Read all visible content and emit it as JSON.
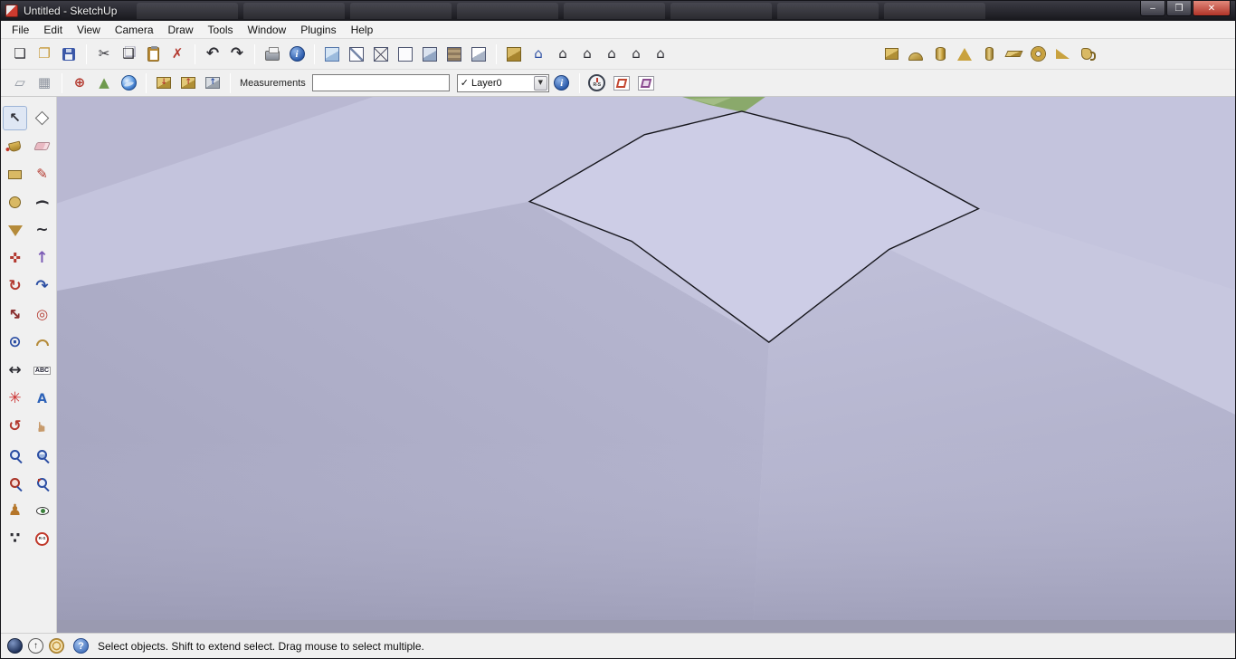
{
  "window": {
    "title": "Untitled - SketchUp",
    "controls": {
      "minimize": "–",
      "maximize": "❒",
      "close": "✕"
    }
  },
  "menu": {
    "items": [
      "File",
      "Edit",
      "View",
      "Camera",
      "Draw",
      "Tools",
      "Window",
      "Plugins",
      "Help"
    ]
  },
  "glyphs": {
    "new": "❏",
    "open": "❐",
    "cut": "✂",
    "copy": "❑",
    "delete": "✗",
    "undo": "↶",
    "redo": "↷",
    "info_i": "i",
    "house": "⌂",
    "check": "✓",
    "arrow_down": "▼",
    "up": "↑",
    "down": "↓",
    "contours": "▱",
    "scratch": "▦",
    "add_location": "⊕",
    "terrain": "▲",
    "select": "↖",
    "line": "✎",
    "arc": "(",
    "freehand": "~",
    "move": "✜",
    "pushpull": "↑",
    "rotate": "↻",
    "follow_me": "↷",
    "scale": "↔",
    "offset": "◎",
    "tape": "⊙",
    "dimension": "↔",
    "text": "ABC",
    "axes": "✳",
    "text3d": "A",
    "orbit": "↺",
    "pan": "☛",
    "camera": "♟",
    "walk": "∵",
    "rs": "R-S",
    "help": "?"
  },
  "toolbar_second": {
    "measurements_label": "Measurements",
    "measurements_value": "",
    "layer_selected": "Layer0"
  },
  "status": {
    "help_text": "Select objects. Shift to extend select. Drag mouse to select multiple."
  },
  "viewport_colors": {
    "base": "#c4c4dd",
    "bright_face": "#cdcde6",
    "left_shadow": "#a3a3bd",
    "right_slope": "#adadc7",
    "bottom_edge": "#9a9ab0",
    "green_patch": "#8aa96b",
    "edge_line": "#16161c"
  }
}
